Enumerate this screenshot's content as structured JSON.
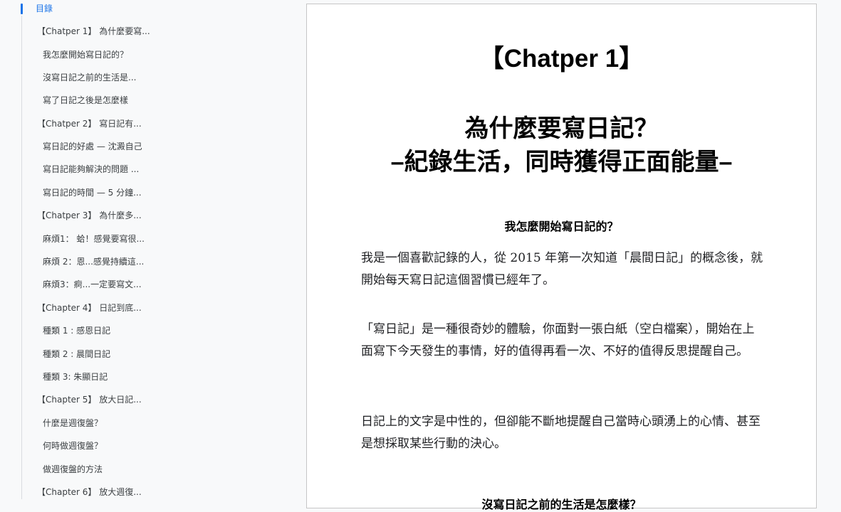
{
  "outline": {
    "title": "目錄",
    "items": [
      {
        "label": "【Chatper 1】 為什麼要寫..."
      },
      {
        "label": "我怎麼開始寫日記的？"
      },
      {
        "label": "沒寫日記之前的生活是..."
      },
      {
        "label": "寫了日記之後是怎麼樣"
      },
      {
        "label": "【Chatper 2】 寫日記有..."
      },
      {
        "label": "寫日記的好處 — 沈澱自己"
      },
      {
        "label": "寫日記能夠解決的問題 ..."
      },
      {
        "label": "寫日記的時間 — 5 分鐘..."
      },
      {
        "label": "【Chatper 3】 為什麼多..."
      },
      {
        "label": "麻煩1： 蛤！感覺要寫很..."
      },
      {
        "label": "麻煩 2：恩...感覺持續這..."
      },
      {
        "label": "麻煩3：痾...一定要寫文..."
      },
      {
        "label": "【Chapter 4】 日記到底..."
      },
      {
        "label": "種類 1 : 感恩日記"
      },
      {
        "label": "種類 2 : 晨間日記"
      },
      {
        "label": "種類 3: 朱顯日記"
      },
      {
        "label": "【Chapter 5】 放大日記..."
      },
      {
        "label": "什麼是週復盤？"
      },
      {
        "label": "何時做週復盤？"
      },
      {
        "label": "做週復盤的方法"
      },
      {
        "label": "【Chapter 6】 放大週復..."
      }
    ]
  },
  "document": {
    "title_line1": "【Chatper 1】",
    "title_line2": "為什麼要寫日記？",
    "title_line3": "–紀錄生活，同時獲得正面能量–",
    "heading_1": "我怎麼開始寫日記的？",
    "paragraph_1": "我是一個喜歡記錄的人，從 2015 年第一次知道「晨間日記」的概念後，就開始每天寫日記這個習慣已經年了。",
    "paragraph_2": "「寫日記」是一種很奇妙的體驗，你面對一張白紙（空白檔案），開始在上面寫下今天發生的事情，好的值得再看一次、不好的值得反思提醒自己。",
    "paragraph_3": "日記上的文字是中性的，但卻能不斷地提醒自己當時心頭湧上的心情、甚至是想採取某些行動的決心。",
    "heading_2": "沒寫日記之前的生活是怎麼樣？"
  }
}
